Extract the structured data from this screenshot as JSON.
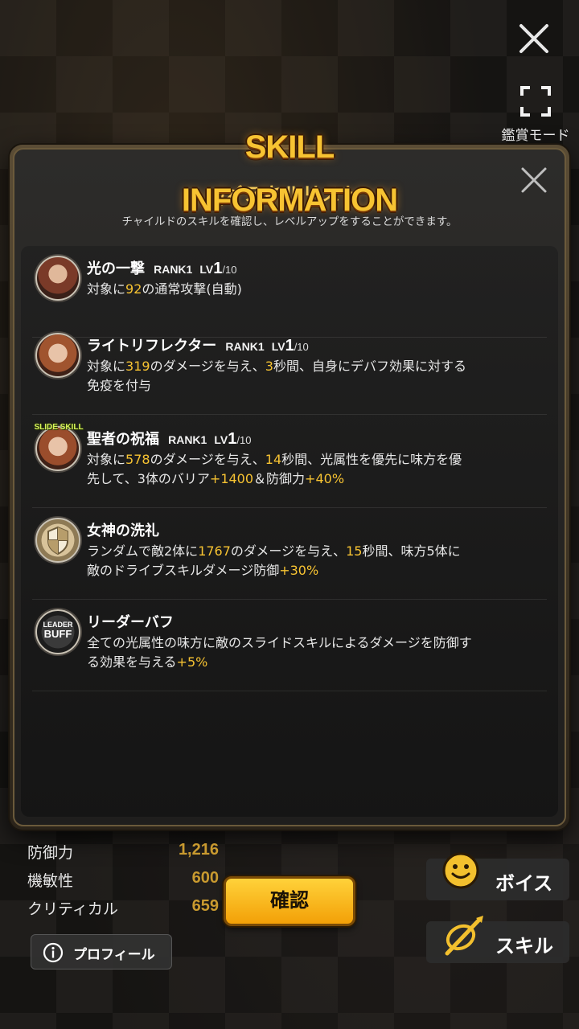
{
  "top": {
    "view_mode_label": "鑑賞モード"
  },
  "modal": {
    "banner": "SKILL INFORMATION",
    "title": "スキルリスト",
    "subtitle": "チャイルドのスキルを確認し、レベルアップをすることができます。"
  },
  "skills": [
    {
      "name": "光の一撃",
      "rank": "RANK1",
      "lv_prefix": "LV",
      "lv": "1",
      "lv_max": "/10",
      "desc": [
        {
          "t": "対象に",
          "h": false
        },
        {
          "t": "92",
          "h": true
        },
        {
          "t": "の通常攻撃(自動)",
          "h": false
        }
      ]
    },
    {
      "name": "ライトリフレクター",
      "rank": "RANK1",
      "lv_prefix": "LV",
      "lv": "1",
      "lv_max": "/10",
      "desc": [
        {
          "t": "対象に",
          "h": false
        },
        {
          "t": "319",
          "h": true
        },
        {
          "t": "のダメージを与え、",
          "h": false
        },
        {
          "t": "3",
          "h": true
        },
        {
          "t": "秒間、自身にデバフ効果に対する免疫を付与",
          "h": false
        }
      ]
    },
    {
      "name": "聖者の祝福",
      "rank": "RANK1",
      "lv_prefix": "LV",
      "lv": "1",
      "lv_max": "/10",
      "badge": "SLIDE SKILL",
      "desc": [
        {
          "t": "対象に",
          "h": false
        },
        {
          "t": "578",
          "h": true
        },
        {
          "t": "のダメージを与え、",
          "h": false
        },
        {
          "t": "14",
          "h": true
        },
        {
          "t": "秒間、光属性を優先に味方を優先して、3体のバリア",
          "h": false
        },
        {
          "t": "+1400",
          "h": true
        },
        {
          "t": "＆防御力",
          "h": false
        },
        {
          "t": "+40%",
          "h": true
        }
      ]
    },
    {
      "name": "女神の洗礼",
      "desc": [
        {
          "t": "ランダムで敵2体に",
          "h": false
        },
        {
          "t": "1767",
          "h": true
        },
        {
          "t": "のダメージを与え、",
          "h": false
        },
        {
          "t": "15",
          "h": true
        },
        {
          "t": "秒間、味方5体に敵のドライブスキルダメージ防御",
          "h": false
        },
        {
          "t": "+30%",
          "h": true
        }
      ]
    },
    {
      "name": "リーダーバフ",
      "badge_top": "LEADER",
      "badge_bottom": "BUFF",
      "desc": [
        {
          "t": "全ての光属性の味方に敵のスライドスキルによるダメージを防御する効果を与える",
          "h": false
        },
        {
          "t": "+5%",
          "h": true
        }
      ]
    }
  ],
  "stats": [
    {
      "label": "防御力",
      "value": "1,216"
    },
    {
      "label": "機敏性",
      "value": "600"
    },
    {
      "label": "クリティカル",
      "value": "659"
    }
  ],
  "buttons": {
    "confirm": "確認",
    "profile": "プロフィール",
    "voice": "ボイス",
    "skill": "スキル"
  }
}
